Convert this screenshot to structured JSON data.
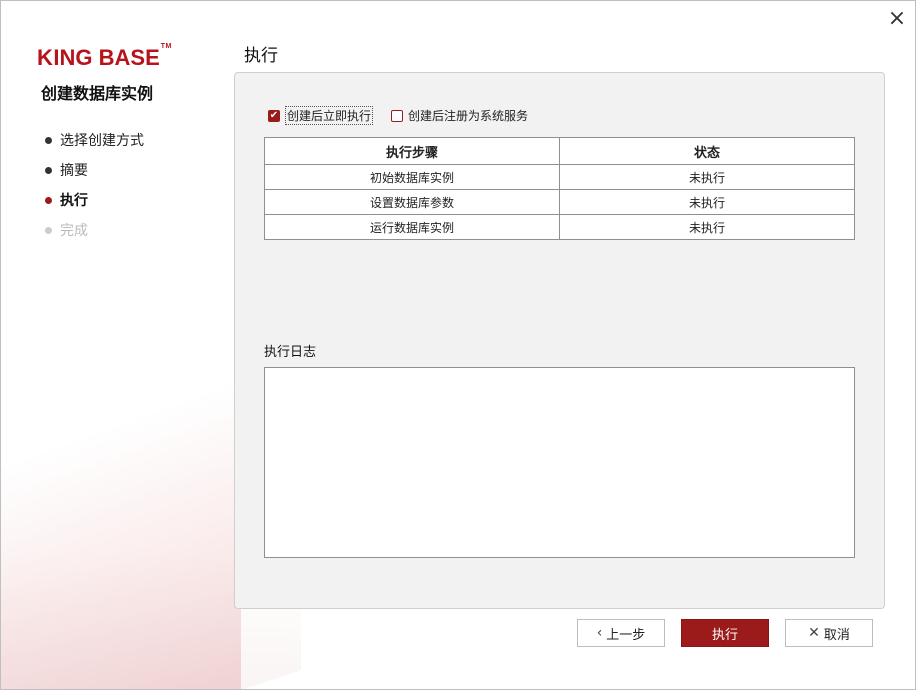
{
  "window": {
    "close_icon": "×"
  },
  "brand": {
    "logo_text": "KINGBASE",
    "logo_tm": "TM",
    "wizard_title": "创建数据库实例",
    "accent_color": "#9b1a1a"
  },
  "steps": [
    {
      "label": "选择创建方式",
      "state": "done"
    },
    {
      "label": "摘要",
      "state": "done"
    },
    {
      "label": "执行",
      "state": "active"
    },
    {
      "label": "完成",
      "state": "pending"
    }
  ],
  "page": {
    "title": "执行",
    "options": {
      "run_after_create": {
        "label": "创建后立即执行",
        "checked": true
      },
      "register_service": {
        "label": "创建后注册为系统服务",
        "checked": false
      }
    },
    "table": {
      "headers": [
        "执行步骤",
        "状态"
      ],
      "rows": [
        {
          "step": "初始数据库实例",
          "status": "未执行"
        },
        {
          "step": "设置数据库参数",
          "status": "未执行"
        },
        {
          "step": "运行数据库实例",
          "status": "未执行"
        }
      ]
    },
    "log_label": "执行日志",
    "log_text": ""
  },
  "footer": {
    "prev_label": "上一步",
    "run_label": "执行",
    "cancel_label": "取消"
  }
}
